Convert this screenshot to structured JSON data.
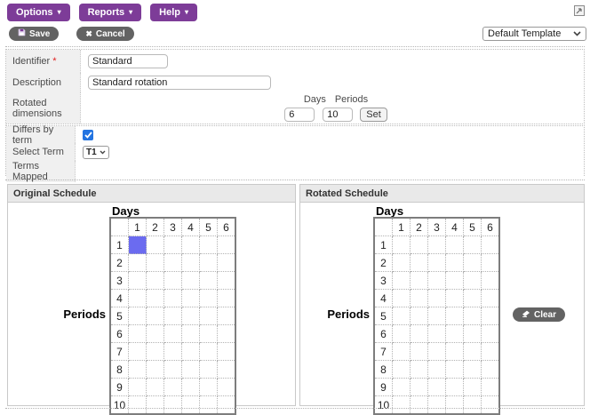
{
  "colors": {
    "purple": "#7d3c98",
    "button-gray": "#636363",
    "highlight-blue": "#6b6bf0",
    "checkbox-blue": "#2374e1",
    "panel-header-bg": "#e9e9e9",
    "label-col-bg": "#f0f0f0"
  },
  "icons": {
    "caret_down": "▾",
    "close": "✖"
  },
  "toolbar": {
    "options_label": "Options",
    "reports_label": "Reports",
    "help_label": "Help"
  },
  "actions": {
    "save_label": "Save",
    "cancel_label": "Cancel"
  },
  "template_select": {
    "value": "Default Template"
  },
  "form": {
    "identifier": {
      "label": "Identifier",
      "required_mark": "*",
      "value": "Standard"
    },
    "description": {
      "label": "Description",
      "value": "Standard rotation"
    },
    "rotated_dimensions": {
      "label": "Rotated dimensions",
      "days_label": "Days",
      "periods_label": "Periods",
      "days_value": "6",
      "periods_value": "10",
      "set_label": "Set"
    },
    "differs_by_term": {
      "label": "Differs by term",
      "checked": true
    },
    "select_term": {
      "label": "Select Term",
      "value": "T1"
    },
    "terms_mapped": {
      "label": "Terms Mapped",
      "value": ""
    }
  },
  "schedules": {
    "days_axis_label": "Days",
    "periods_axis_label": "Periods",
    "days": 6,
    "periods": 10,
    "original": {
      "title": "Original Schedule",
      "highlighted_cells": [
        {
          "day": 1,
          "period": 1
        }
      ]
    },
    "rotated": {
      "title": "Rotated Schedule",
      "highlighted_cells": []
    },
    "clear_label": "Clear"
  }
}
